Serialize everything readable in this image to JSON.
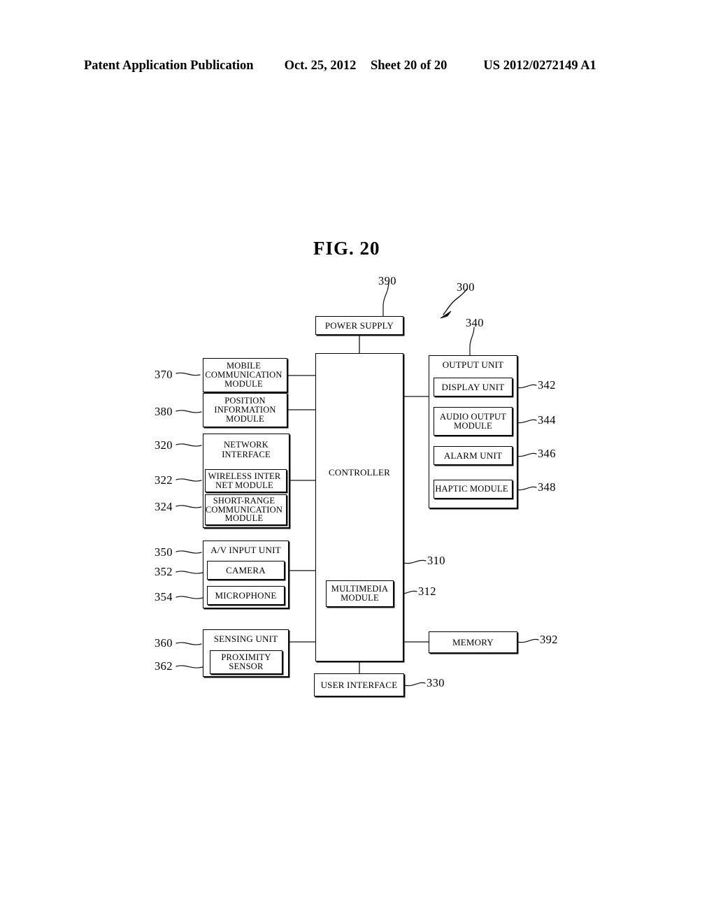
{
  "header": {
    "publication": "Patent Application Publication",
    "date": "Oct. 25, 2012",
    "sheet": "Sheet 20 of 20",
    "number": "US 2012/0272149 A1"
  },
  "figure": {
    "title": "FIG. 20",
    "device_ref": "300"
  },
  "blocks": {
    "power_supply": {
      "label": "POWER SUPPLY",
      "ref": "390"
    },
    "controller": {
      "label": "CONTROLLER",
      "ref": "310"
    },
    "multimedia_module": {
      "label": "MULTIMEDIA MODULE",
      "ref": "312"
    },
    "mobile_comm": {
      "label": "MOBILE COMMUNICATION MODULE",
      "ref": "370"
    },
    "position_info": {
      "label": "POSITION INFORMATION MODULE",
      "ref": "380"
    },
    "network_interface": {
      "label": "NETWORK INTERFACE",
      "ref": "320"
    },
    "wireless_internet": {
      "label": "WIRELESS INTER NET MODULE",
      "ref": "322"
    },
    "short_range": {
      "label": "SHORT-RANGE COMMUNICATION MODULE",
      "ref": "324"
    },
    "av_input": {
      "label": "A/V INPUT UNIT",
      "ref": "350"
    },
    "camera": {
      "label": "CAMERA",
      "ref": "352"
    },
    "microphone": {
      "label": "MICROPHONE",
      "ref": "354"
    },
    "sensing_unit": {
      "label": "SENSING UNIT",
      "ref": "360"
    },
    "proximity_sensor": {
      "label": "PROXIMITY SENSOR",
      "ref": "362"
    },
    "output_unit": {
      "label": "OUTPUT UNIT",
      "ref": "340"
    },
    "display_unit": {
      "label": "DISPLAY UNIT",
      "ref": "342"
    },
    "audio_output": {
      "label": "AUDIO OUTPUT MODULE",
      "ref": "344"
    },
    "alarm_unit": {
      "label": "ALARM UNIT",
      "ref": "346"
    },
    "haptic_module": {
      "label": "HAPTIC MODULE",
      "ref": "348"
    },
    "memory": {
      "label": "MEMORY",
      "ref": "392"
    },
    "user_interface": {
      "label": "USER INTERFACE",
      "ref": "330"
    }
  }
}
